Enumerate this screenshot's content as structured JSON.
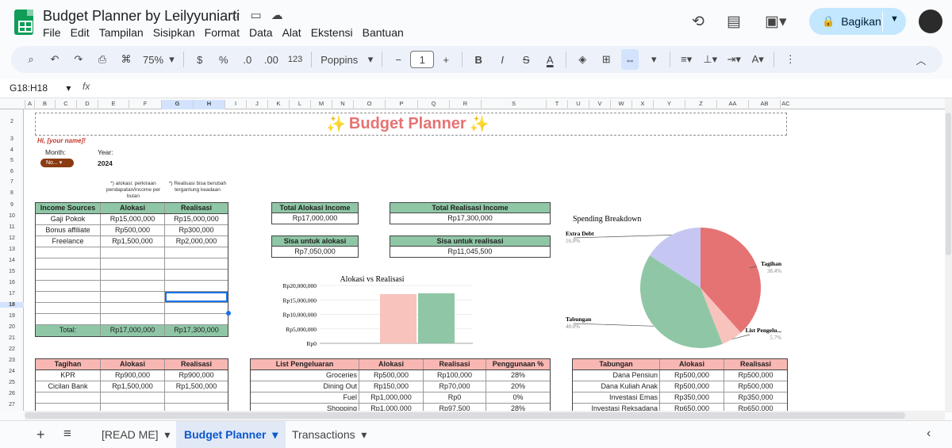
{
  "doc": {
    "title": "Budget Planner by Leilyyuniarti"
  },
  "menu": [
    "File",
    "Edit",
    "Tampilan",
    "Sisipkan",
    "Format",
    "Data",
    "Alat",
    "Ekstensi",
    "Bantuan"
  ],
  "share": {
    "label": "Bagikan"
  },
  "toolbar": {
    "zoom": "75%",
    "currency": "$",
    "percent": "%",
    "dec_less": ".0",
    "dec_more": ".00",
    "number_format": "123",
    "font": "Poppins",
    "font_size": "1"
  },
  "formula": {
    "name_box": "G18:H18",
    "fx": "fx",
    "value": ""
  },
  "columns": [
    "A",
    "B",
    "C",
    "D",
    "E",
    "F",
    "G",
    "H",
    "I",
    "J",
    "K",
    "L",
    "M",
    "N",
    "O",
    "P",
    "Q",
    "R",
    "S",
    "T",
    "U",
    "V",
    "W",
    "X",
    "Y",
    "Z",
    "AA",
    "AB",
    "AC"
  ],
  "rows": [
    "2",
    "3",
    "4",
    "5",
    "6",
    "7",
    "8",
    "9",
    "10",
    "11",
    "12",
    "13",
    "14",
    "15",
    "16",
    "17",
    "18",
    "19",
    "20",
    "21",
    "22",
    "23",
    "24",
    "25",
    "26",
    "27"
  ],
  "planner": {
    "title": "Budget Planner",
    "greeting": "Hi, [your name]!",
    "month_label": "Month:",
    "month_value": "No...",
    "year_label": "Year:",
    "year_value": "2024",
    "note_alokasi": "*) alokasi: perkiraan pendapatan/income per bulan",
    "note_realisasi": "*) Realisasi bisa berubah tergantung keadaan"
  },
  "income": {
    "headers": [
      "Income Sources",
      "Alokasi",
      "Realisasi"
    ],
    "rows": [
      [
        "Gaji Pokok",
        "Rp15,000,000",
        "Rp15,000,000"
      ],
      [
        "Bonus affiliate",
        "Rp500,000",
        "Rp300,000"
      ],
      [
        "Freelance",
        "Rp1,500,000",
        "Rp2,000,000"
      ]
    ],
    "total_label": "Total:",
    "total_alokasi": "Rp17,000,000",
    "total_realisasi": "Rp17,300,000"
  },
  "summary": {
    "total_alokasi_label": "Total Alokasi Income",
    "total_alokasi_value": "Rp17,000,000",
    "total_realisasi_label": "Total Realisasi Income",
    "total_realisasi_value": "Rp17,300,000",
    "sisa_alokasi_label": "Sisa untuk alokasi",
    "sisa_alokasi_value": "Rp7,050,000",
    "sisa_realisasi_label": "Sisa untuk realisasi",
    "sisa_realisasi_value": "Rp11,045,500"
  },
  "tagihan": {
    "headers": [
      "Tagihan",
      "Alokasi",
      "Realisasi"
    ],
    "rows": [
      [
        "KPR",
        "Rp900,000",
        "Rp900,000"
      ],
      [
        "Cicilan Bank",
        "Rp1,500,000",
        "Rp1,500,000"
      ]
    ]
  },
  "pengeluaran": {
    "headers": [
      "List Pengeluaran",
      "Alokasi",
      "Realisasi",
      "Penggunaan %"
    ],
    "rows": [
      [
        "Groceries",
        "Rp500,000",
        "Rp100,000",
        "28%"
      ],
      [
        "Dining Out",
        "Rp150,000",
        "Rp70,000",
        "20%"
      ],
      [
        "Fuel",
        "Rp1,000,000",
        "Rp0",
        "0%"
      ],
      [
        "Shopping",
        "Rp1,000,000",
        "Rp97,500",
        "28%"
      ]
    ]
  },
  "tabungan": {
    "headers": [
      "Tabungan",
      "Alokasi",
      "Realisasi"
    ],
    "rows": [
      [
        "Dana Pensiun",
        "Rp500,000",
        "Rp500,000"
      ],
      [
        "Dana Kuliah Anak",
        "Rp500,000",
        "Rp500,000"
      ],
      [
        "Investasi Emas",
        "Rp350,000",
        "Rp350,000"
      ],
      [
        "Investasi Reksadana",
        "Rp650,000",
        "Rp650,000"
      ]
    ]
  },
  "chart_data": [
    {
      "type": "bar",
      "title": "Alokasi vs Realisasi",
      "categories": [
        ""
      ],
      "series": [
        {
          "values": [
            17000000
          ],
          "color": "#f8c2bd"
        },
        {
          "values": [
            17300000
          ],
          "color": "#8fc7a6"
        }
      ],
      "yticks": [
        "Rp20,000,000",
        "Rp15,000,000",
        "Rp10,000,000",
        "Rp5,000,000",
        "Rp0"
      ],
      "ylim": [
        0,
        20000000
      ]
    },
    {
      "type": "pie",
      "title": "Spending Breakdown",
      "labels": [
        "Tagihan",
        "List Pengelu...",
        "Tabungan",
        "Extra Debt"
      ],
      "values": [
        38.4,
        5.7,
        40.0,
        16.0
      ],
      "percent_labels": [
        "38.4%",
        "5.7%",
        "40.0%",
        "16.0%"
      ],
      "colors": [
        "#e57373",
        "#f8c2bd",
        "#8fc7a6",
        "#c5c7f2"
      ]
    }
  ],
  "sheets": [
    "[READ ME]",
    "Budget Planner",
    "Transactions"
  ],
  "active_sheet": "Budget Planner"
}
